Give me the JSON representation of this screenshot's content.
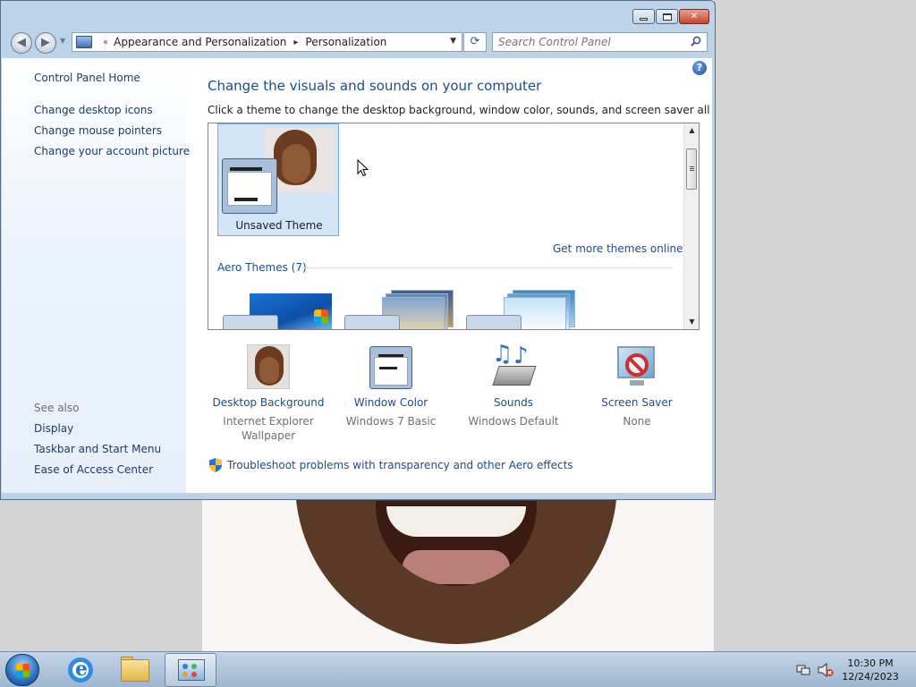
{
  "navigation": {
    "breadcrumb_prefix": "«",
    "breadcrumbs": [
      "Appearance and Personalization",
      "Personalization"
    ],
    "search_placeholder": "Search Control Panel"
  },
  "sidebar": {
    "home_link": "Control Panel Home",
    "tasks": [
      "Change desktop icons",
      "Change mouse pointers",
      "Change your account picture"
    ],
    "see_also_heading": "See also",
    "see_also": [
      "Display",
      "Taskbar and Start Menu",
      "Ease of Access Center"
    ]
  },
  "main": {
    "title": "Change the visuals and sounds on your computer",
    "description": "Click a theme to change the desktop background, window color, sounds, and screen saver all at once.",
    "gallery": {
      "my_themes": [
        {
          "label": "Unsaved Theme",
          "selected": true
        }
      ],
      "get_more_link": "Get more themes online",
      "aero_group_label": "Aero Themes (7)"
    },
    "items": [
      {
        "title": "Desktop Background",
        "subtitle": [
          "Internet Explorer",
          "Wallpaper"
        ],
        "icon": "desktop-background-icon"
      },
      {
        "title": "Window Color",
        "subtitle": [
          "Windows 7 Basic"
        ],
        "icon": "window-color-icon"
      },
      {
        "title": "Sounds",
        "subtitle": [
          "Windows Default"
        ],
        "icon": "sounds-icon"
      },
      {
        "title": "Screen Saver",
        "subtitle": [
          "None"
        ],
        "icon": "screen-saver-icon"
      }
    ],
    "troubleshoot_link": "Troubleshoot problems with transparency and other Aero effects"
  },
  "taskbar": {
    "pinned": [
      "internet-explorer-icon",
      "windows-explorer-icon",
      "control-panel-icon"
    ],
    "active_app": "control-panel-icon",
    "clock": {
      "time": "10:30 PM",
      "date": "12/24/2023"
    }
  },
  "colors": {
    "link": "#1c4c8c",
    "title": "#1c4c8c",
    "selection": "#d2e5f7",
    "sidebar": "#e7f0fa"
  }
}
